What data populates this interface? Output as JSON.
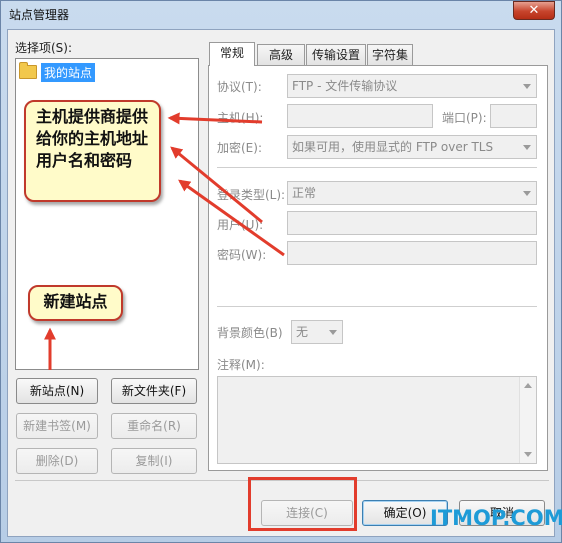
{
  "window": {
    "title": "站点管理器",
    "close_glyph": "✕"
  },
  "left": {
    "select_label": "选择项(S):",
    "tree": [
      {
        "label": "我的站点",
        "icon": "folder-icon"
      }
    ],
    "buttons": {
      "new_site": "新站点(N)",
      "new_folder": "新文件夹(F)",
      "new_bookmark": "新建书签(M)",
      "rename": "重命名(R)",
      "delete": "删除(D)",
      "copy": "复制(I)"
    }
  },
  "tabs": [
    {
      "label": "常规",
      "active": true
    },
    {
      "label": "高级",
      "active": false
    },
    {
      "label": "传输设置",
      "active": false
    },
    {
      "label": "字符集",
      "active": false
    }
  ],
  "general": {
    "protocol_label": "协议(T):",
    "protocol_value": "FTP - 文件传输协议",
    "host_label": "主机(H):",
    "host_value": "",
    "port_label": "端口(P):",
    "port_value": "",
    "encryption_label": "加密(E):",
    "encryption_value": "如果可用，使用显式的 FTP over TLS",
    "logon_type_label": "登录类型(L):",
    "logon_type_value": "正常",
    "user_label": "用户(U):",
    "user_value": "",
    "password_label": "密码(W):",
    "password_value": "",
    "bg_color_label": "背景颜色(B)",
    "bg_color_value": "无",
    "comments_label": "注释(M):",
    "comments_value": ""
  },
  "footer": {
    "connect": "连接(C)",
    "ok": "确定(O)",
    "cancel": "取消"
  },
  "annotations": {
    "host_callout": "主机提供商提供给你的主机地址用户名和密码",
    "new_site_callout": "新建站点",
    "accent_color": "#e23c2c"
  },
  "watermark": "ITMOP.COM"
}
